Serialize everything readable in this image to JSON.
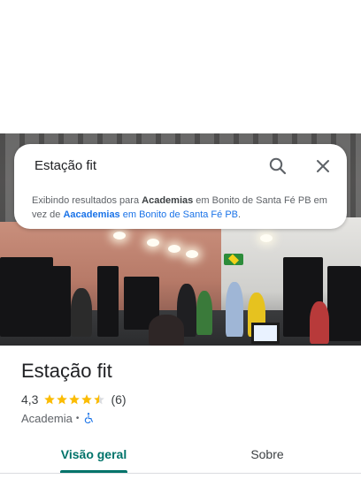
{
  "search": {
    "query": "Estação fit",
    "note_prefix": "Exibindo resultados para ",
    "note_corrected": "Academias",
    "note_middle": " em Bonito de Santa Fé PB em vez de ",
    "note_original": "Aacademias",
    "note_original_suffix": " em Bonito de Santa Fé PB",
    "note_end": "."
  },
  "place": {
    "title": "Estação fit",
    "rating": "4,3",
    "stars": 4.3,
    "review_count": "(6)",
    "category": "Academia",
    "separator": "•"
  },
  "tabs": {
    "overview": "Visão geral",
    "about": "Sobre",
    "active": "overview"
  },
  "colors": {
    "accent": "#00736a",
    "star": "#fbbc04",
    "link": "#1a73e8"
  }
}
